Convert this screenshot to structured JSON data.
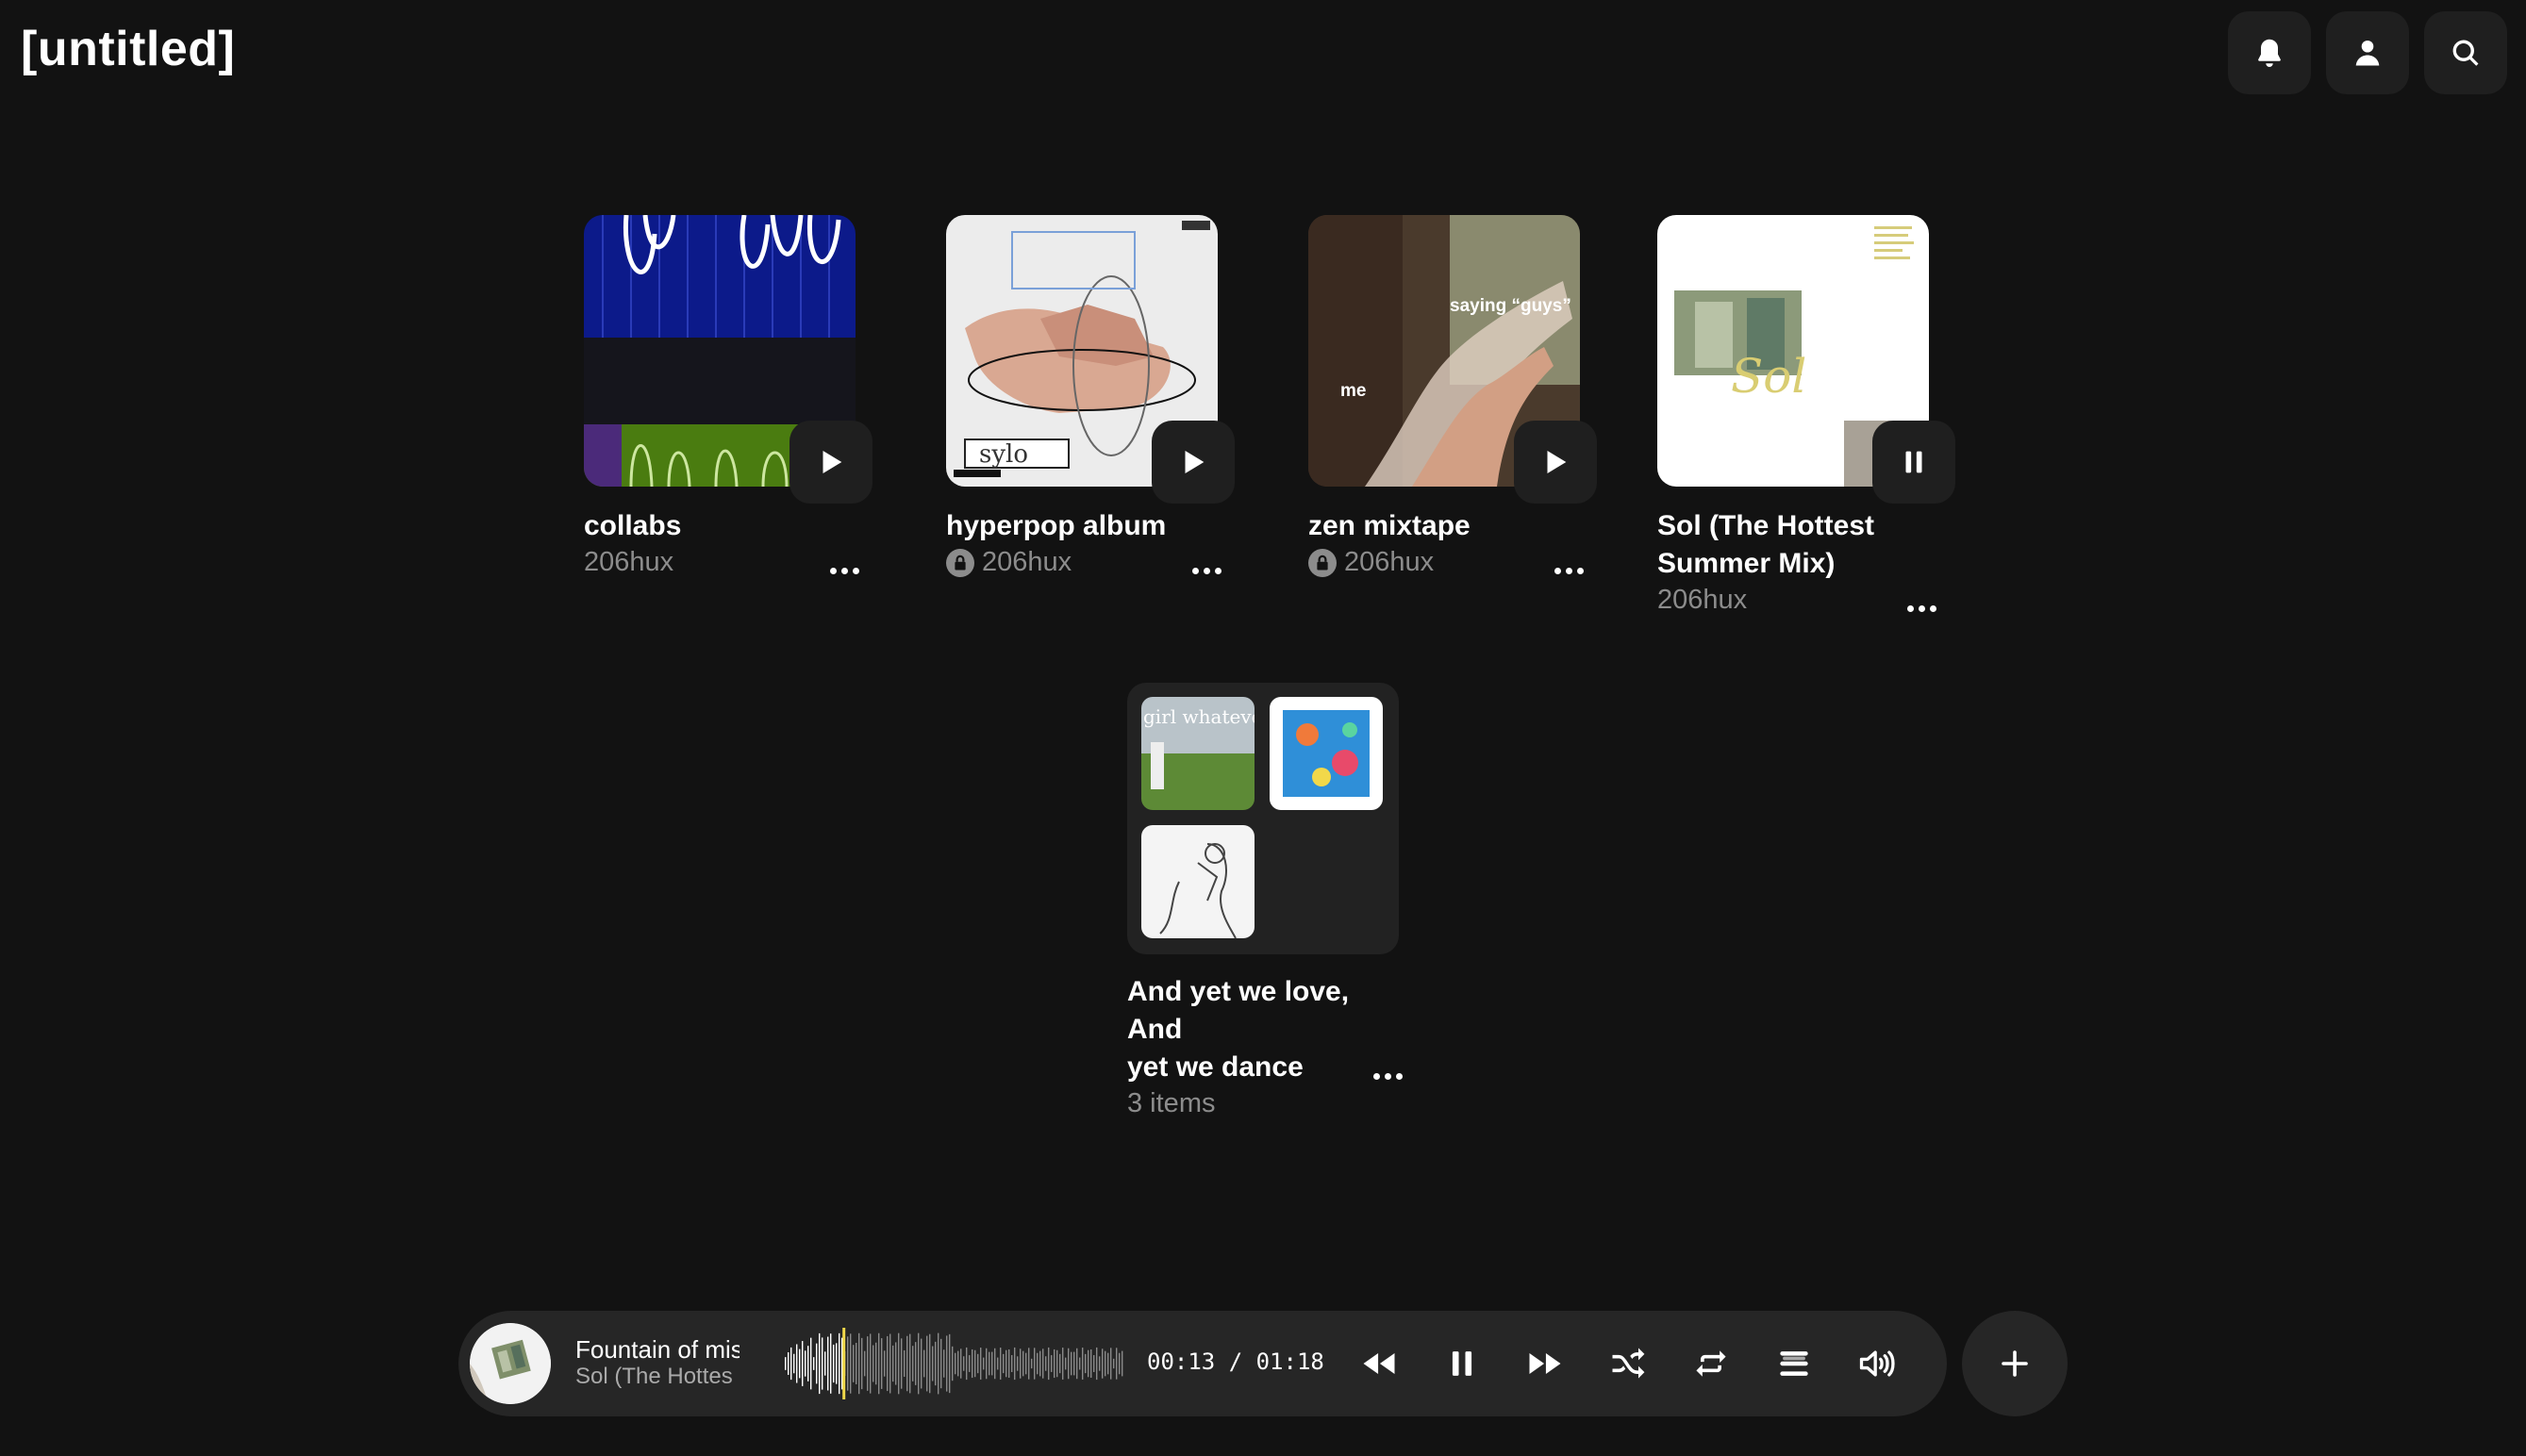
{
  "app": {
    "title": "[untitled]"
  },
  "header": {
    "buttons": [
      {
        "name": "notifications",
        "icon": "bell-icon"
      },
      {
        "name": "profile",
        "icon": "user-icon"
      },
      {
        "name": "search",
        "icon": "search-icon"
      }
    ]
  },
  "playlists": [
    {
      "title": "collabs",
      "owner": "206hux",
      "private": false,
      "state": "paused"
    },
    {
      "title": "hyperpop album",
      "owner": "206hux",
      "private": true,
      "state": "paused"
    },
    {
      "title": "zen mixtape",
      "owner": "206hux",
      "private": true,
      "state": "paused"
    },
    {
      "title": "Sol (The Hottest Summer Mix)",
      "title_line1": "Sol (The Hottest",
      "title_line2": "Summer Mix)",
      "owner": "206hux",
      "private": false,
      "state": "playing"
    }
  ],
  "covers": {
    "zen_mixtape_texts": [
      "saying “guys”",
      "me"
    ],
    "sol_text": "Sol",
    "hyperpop_text": "sylo"
  },
  "folder": {
    "title_line1": "And yet we love, And",
    "title_line2": "yet we dance",
    "subtitle": "3 items",
    "thumb_text": "girl whatever"
  },
  "player": {
    "track_title": "Fountain of mis",
    "track_album": "Sol (The Hottes",
    "time_current": "00:13",
    "time_separator": "/",
    "time_total": "01:18",
    "progress": 0.17,
    "accent_color": "#f0d84a",
    "controls": [
      "rewind-icon",
      "pause-icon",
      "fast-forward-icon",
      "shuffle-icon",
      "repeat-icon",
      "queue-icon",
      "volume-icon"
    ]
  },
  "colors": {
    "background": "#121212",
    "surface": "#1f1f1f",
    "muted_text": "#8c8c8c"
  }
}
